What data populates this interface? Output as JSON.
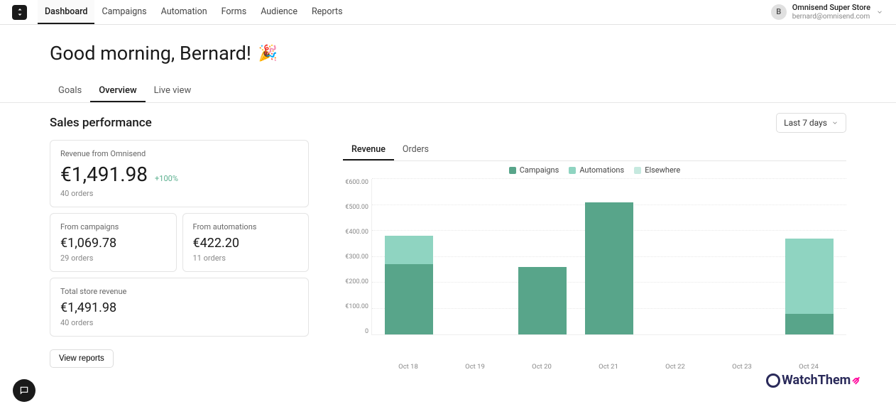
{
  "header": {
    "nav": [
      "Dashboard",
      "Campaigns",
      "Automation",
      "Forms",
      "Audience",
      "Reports"
    ],
    "nav_active": 0,
    "account": {
      "initial": "B",
      "name": "Omnisend Super Store",
      "email": "bernard@omnisend.com"
    }
  },
  "greeting": {
    "text": "Good morning, Bernard!",
    "emoji": "🎉"
  },
  "subtabs": {
    "items": [
      "Goals",
      "Overview",
      "Live view"
    ],
    "active": 1
  },
  "section": {
    "title": "Sales performance",
    "period": "Last 7 days"
  },
  "cards": {
    "hero": {
      "label": "Revenue from Omnisend",
      "value": "€1,491.98",
      "delta": "+100%",
      "sub": "40 orders"
    },
    "camp": {
      "label": "From campaigns",
      "value": "€1,069.78",
      "sub": "29 orders"
    },
    "auto": {
      "label": "From automations",
      "value": "€422.20",
      "sub": "11 orders"
    },
    "total": {
      "label": "Total store revenue",
      "value": "€1,491.98",
      "sub": "40 orders"
    }
  },
  "buttons": {
    "view_reports": "View reports"
  },
  "chart_tabs": {
    "items": [
      "Revenue",
      "Orders"
    ],
    "active": 0
  },
  "legend": {
    "items": [
      {
        "name": "Campaigns",
        "color": "#58a58a"
      },
      {
        "name": "Automations",
        "color": "#8fd4c1"
      },
      {
        "name": "Elsewhere",
        "color": "#c6e9df"
      }
    ]
  },
  "chart_data": {
    "type": "bar",
    "ylabel": "",
    "ylim": [
      0,
      600
    ],
    "y_ticks": [
      "€600.00",
      "€500.00",
      "€400.00",
      "€300.00",
      "€200.00",
      "€100.00",
      "0"
    ],
    "categories": [
      "Oct 18",
      "Oct 19",
      "Oct 20",
      "Oct 21",
      "Oct 22",
      "Oct 23",
      "Oct 24"
    ],
    "series": [
      {
        "name": "Campaigns",
        "color": "#58a58a",
        "values": [
          270,
          0,
          260,
          510,
          0,
          0,
          80
        ]
      },
      {
        "name": "Automations",
        "color": "#8fd4c1",
        "values": [
          110,
          0,
          0,
          0,
          0,
          0,
          290
        ]
      },
      {
        "name": "Elsewhere",
        "color": "#c6e9df",
        "values": [
          0,
          0,
          0,
          0,
          0,
          0,
          0
        ]
      }
    ]
  },
  "watermark": "WatchThem",
  "colors": {
    "blue": "#2a2a5a",
    "pink": "#f09"
  }
}
